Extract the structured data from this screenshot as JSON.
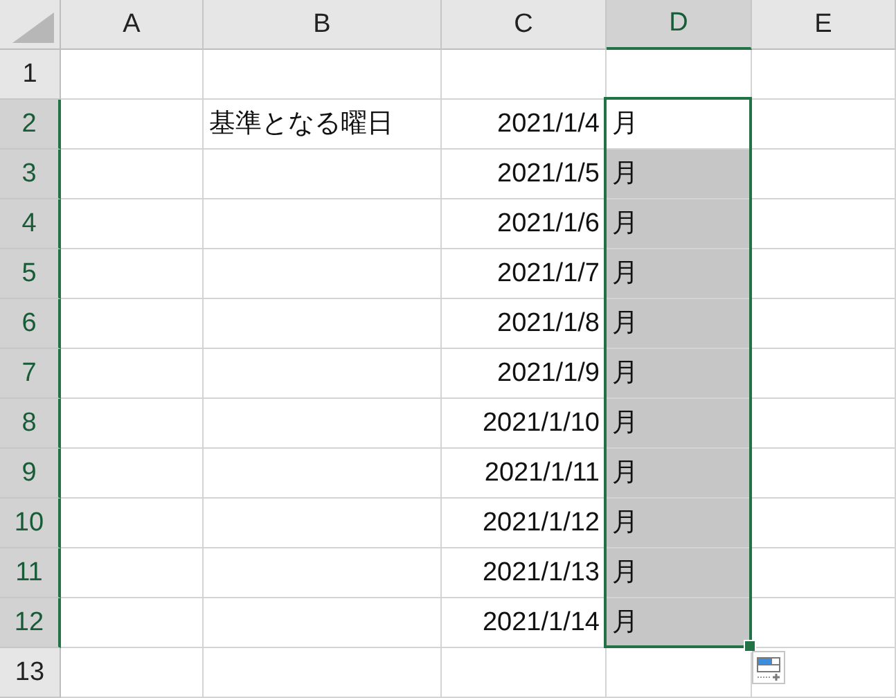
{
  "columns": [
    {
      "label": "A",
      "selected": false
    },
    {
      "label": "B",
      "selected": false
    },
    {
      "label": "C",
      "selected": false
    },
    {
      "label": "D",
      "selected": true
    },
    {
      "label": "E",
      "selected": false
    }
  ],
  "rows": [
    {
      "label": "1",
      "selected": false,
      "active": false,
      "cells": [
        null,
        null,
        null,
        null,
        null
      ]
    },
    {
      "label": "2",
      "selected": true,
      "active": true,
      "cells": [
        null,
        "基準となる曜日",
        "2021/1/4",
        "月",
        null
      ]
    },
    {
      "label": "3",
      "selected": true,
      "active": false,
      "cells": [
        null,
        null,
        "2021/1/5",
        "月",
        null
      ]
    },
    {
      "label": "4",
      "selected": true,
      "active": false,
      "cells": [
        null,
        null,
        "2021/1/6",
        "月",
        null
      ]
    },
    {
      "label": "5",
      "selected": true,
      "active": false,
      "cells": [
        null,
        null,
        "2021/1/7",
        "月",
        null
      ]
    },
    {
      "label": "6",
      "selected": true,
      "active": false,
      "cells": [
        null,
        null,
        "2021/1/8",
        "月",
        null
      ]
    },
    {
      "label": "7",
      "selected": true,
      "active": false,
      "cells": [
        null,
        null,
        "2021/1/9",
        "月",
        null
      ]
    },
    {
      "label": "8",
      "selected": true,
      "active": false,
      "cells": [
        null,
        null,
        "2021/1/10",
        "月",
        null
      ]
    },
    {
      "label": "9",
      "selected": true,
      "active": false,
      "cells": [
        null,
        null,
        "2021/1/11",
        "月",
        null
      ]
    },
    {
      "label": "10",
      "selected": true,
      "active": false,
      "cells": [
        null,
        null,
        "2021/1/12",
        "月",
        null
      ]
    },
    {
      "label": "11",
      "selected": true,
      "active": false,
      "cells": [
        null,
        null,
        "2021/1/13",
        "月",
        null
      ]
    },
    {
      "label": "12",
      "selected": true,
      "active": false,
      "cells": [
        null,
        null,
        "2021/1/14",
        "月",
        null
      ]
    },
    {
      "label": "13",
      "selected": false,
      "active": false,
      "cells": [
        null,
        null,
        null,
        null,
        null
      ]
    }
  ]
}
